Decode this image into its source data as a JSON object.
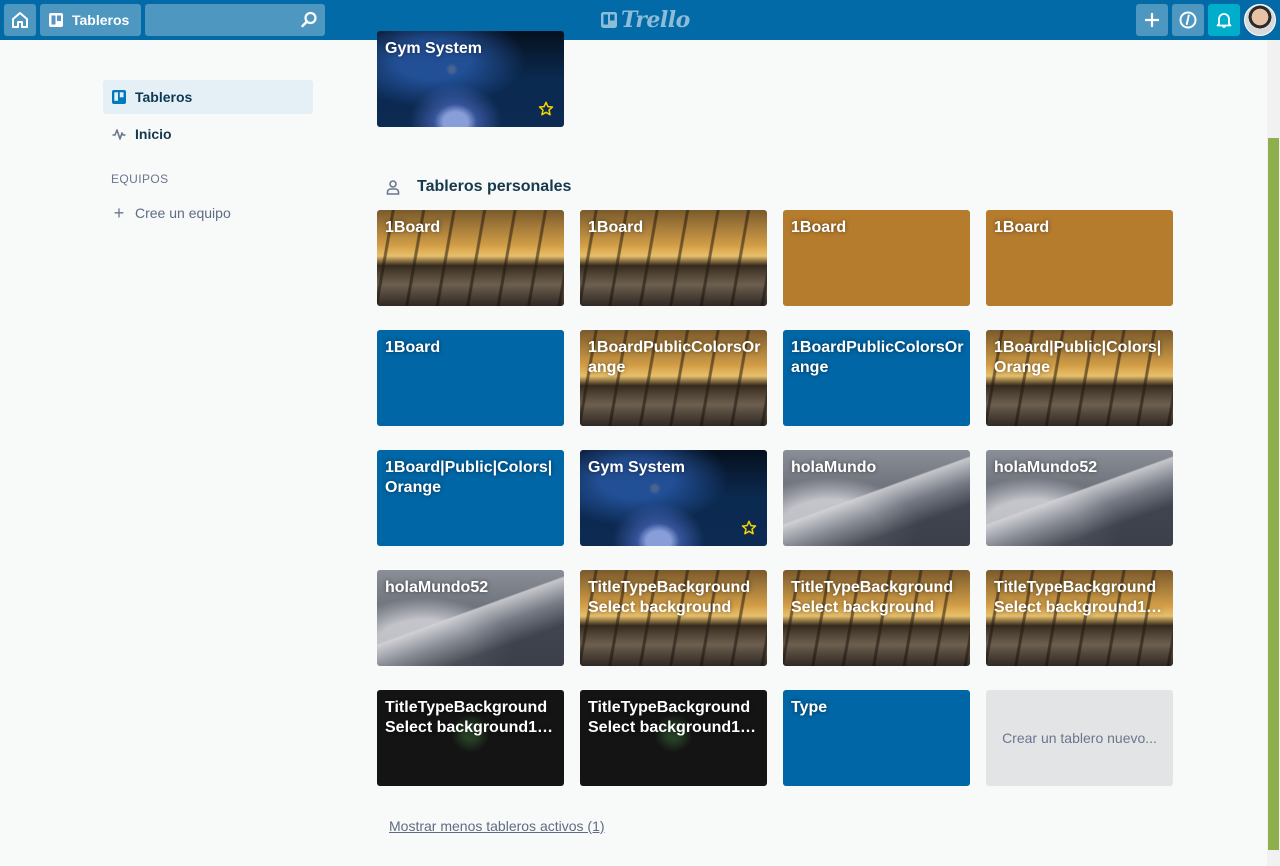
{
  "header": {
    "boards_label": "Tableros",
    "search_placeholder": "",
    "logo_text": "Trello",
    "icons": [
      "home-icon",
      "board-icon",
      "search-icon",
      "plus-icon",
      "info-icon",
      "bell-icon"
    ],
    "colors": {
      "bar": "#026aa7",
      "notification": "#00aecc"
    }
  },
  "sidebar": {
    "items": [
      {
        "label": "Tableros",
        "icon": "board-icon",
        "active": true
      },
      {
        "label": "Inicio",
        "icon": "activity-icon",
        "active": false
      }
    ],
    "teams_heading": "EQUIPOS",
    "create_team_label": "Cree un equipo"
  },
  "starred": {
    "boards": [
      {
        "title": "Gym System",
        "background": "castle",
        "starred": true
      }
    ]
  },
  "personal": {
    "heading": "Tableros personales",
    "boards": [
      {
        "title": "1Board",
        "background": "snow"
      },
      {
        "title": "1Board",
        "background": "snow"
      },
      {
        "title": "1Board",
        "background": "orange"
      },
      {
        "title": "1Board",
        "background": "orange"
      },
      {
        "title": "1Board",
        "background": "blue"
      },
      {
        "title": "1BoardPublicColorsOrange",
        "background": "snow"
      },
      {
        "title": "1BoardPublicColorsOrange",
        "background": "blue"
      },
      {
        "title": "1Board|Public|Colors|Orange",
        "background": "snow"
      },
      {
        "title": "1Board|Public|Colors|Orange",
        "background": "blue"
      },
      {
        "title": "Gym System",
        "background": "castle",
        "starred": true
      },
      {
        "title": "holaMundo",
        "background": "mountain"
      },
      {
        "title": "holaMundo52",
        "background": "mountain"
      },
      {
        "title": "holaMundo52",
        "background": "mountain"
      },
      {
        "title": "TitleTypeBackground Select background",
        "background": "snow"
      },
      {
        "title": "TitleTypeBackground Select background",
        "background": "snow"
      },
      {
        "title": "TitleTypeBackground Select background1…",
        "background": "snow"
      },
      {
        "title": "TitleTypeBackground Select background1…",
        "background": "firework"
      },
      {
        "title": "TitleTypeBackground Select background1…",
        "background": "firework"
      },
      {
        "title": "Type",
        "background": "blue"
      }
    ],
    "create_label": "Crear un tablero nuevo..."
  },
  "footer": {
    "show_less_label": "Mostrar menos tableros activos (1)"
  }
}
